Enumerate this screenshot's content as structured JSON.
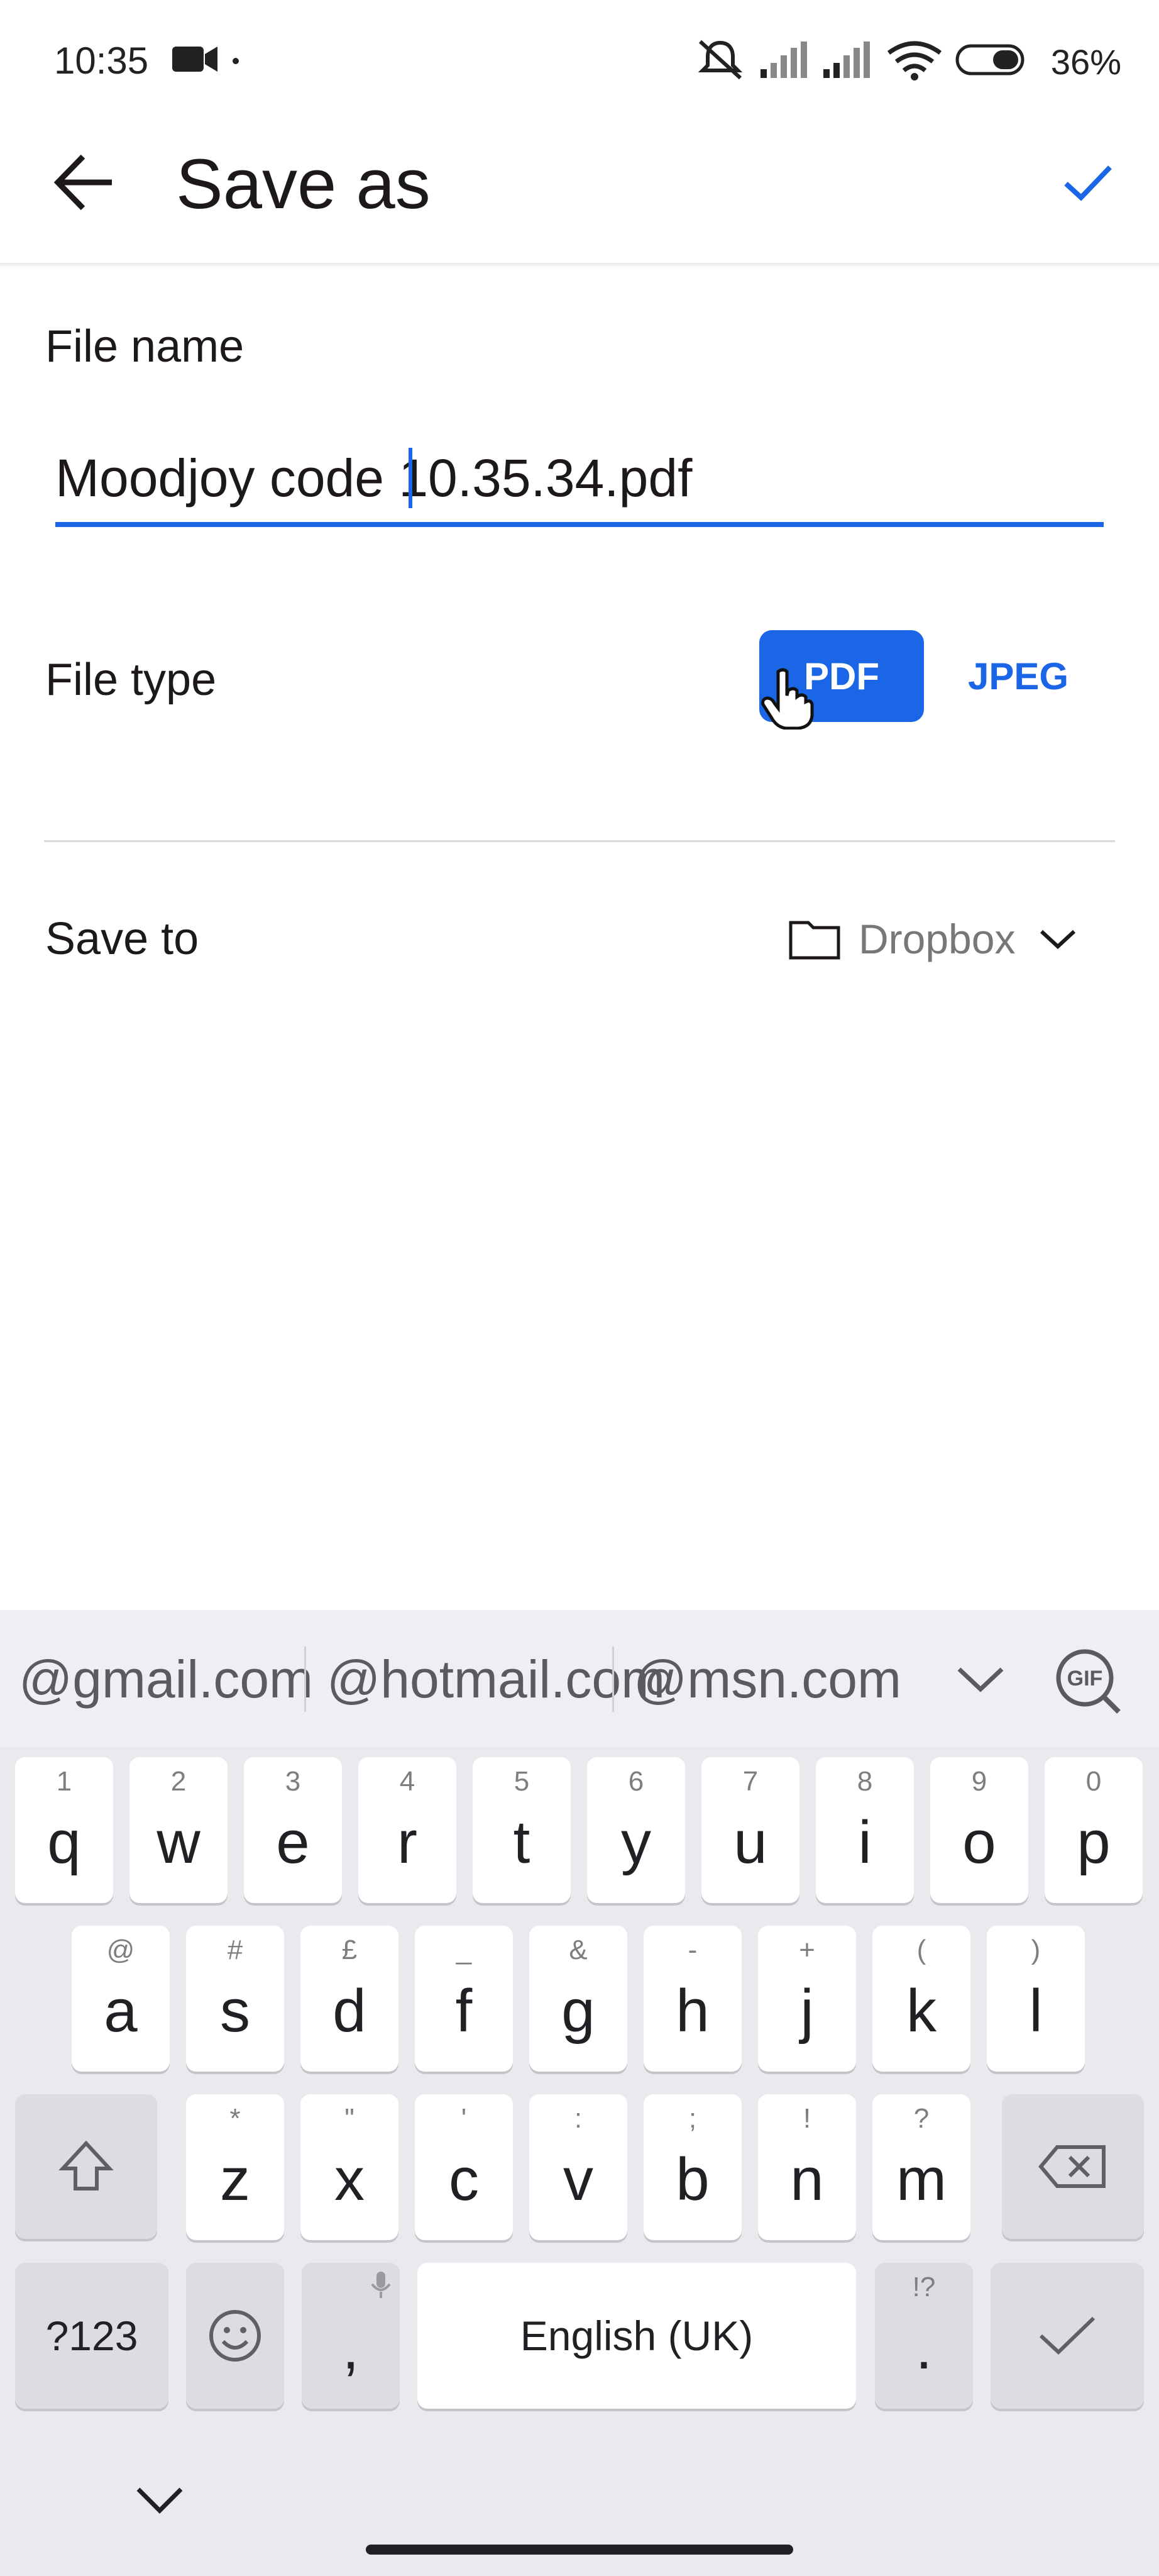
{
  "status_bar": {
    "time": "10:35",
    "battery": "36%"
  },
  "header": {
    "title": "Save as"
  },
  "form": {
    "file_name_label": "File name",
    "file_name_value": "Moodjoy code 10.35.34.pdf",
    "file_type_label": "File type",
    "file_types": [
      "PDF",
      "JPEG"
    ],
    "selected_type": "PDF",
    "save_to_label": "Save to",
    "save_to_value": "Dropbox"
  },
  "keyboard": {
    "suggestions": [
      "@gmail.com",
      "@hotmail.com",
      "@msn.com"
    ],
    "row1": [
      [
        "q",
        "1"
      ],
      [
        "w",
        "2"
      ],
      [
        "e",
        "3"
      ],
      [
        "r",
        "4"
      ],
      [
        "t",
        "5"
      ],
      [
        "y",
        "6"
      ],
      [
        "u",
        "7"
      ],
      [
        "i",
        "8"
      ],
      [
        "o",
        "9"
      ],
      [
        "p",
        "0"
      ]
    ],
    "row2": [
      [
        "a",
        "@"
      ],
      [
        "s",
        "#"
      ],
      [
        "d",
        "£"
      ],
      [
        "f",
        "_"
      ],
      [
        "g",
        "&"
      ],
      [
        "h",
        "-"
      ],
      [
        "j",
        "+"
      ],
      [
        "k",
        "("
      ],
      [
        "l",
        ")"
      ]
    ],
    "row3": [
      [
        "z",
        "*"
      ],
      [
        "x",
        "\""
      ],
      [
        "c",
        "'"
      ],
      [
        "v",
        ":"
      ],
      [
        "b",
        ";"
      ],
      [
        "n",
        "!"
      ],
      [
        "m",
        "?"
      ]
    ],
    "symbols_label": "?123",
    "comma_label": ",",
    "space_label": "English (UK)",
    "period_label": ".",
    "period_hint": "!?"
  },
  "colors": {
    "accent": "#1a66e6",
    "keyboard_bg": "#e9eaee"
  }
}
